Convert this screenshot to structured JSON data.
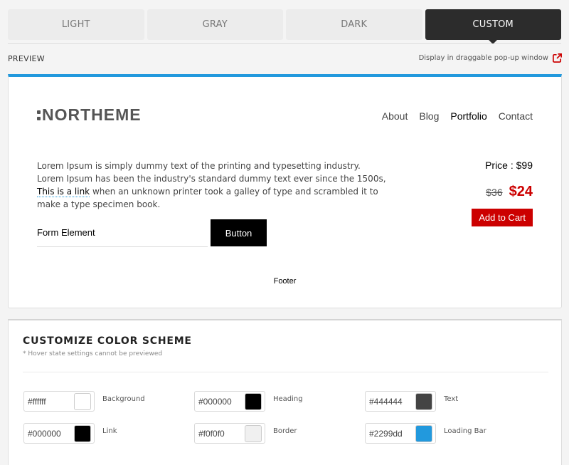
{
  "tabs": [
    {
      "label": "LIGHT",
      "active": false
    },
    {
      "label": "GRAY",
      "active": false
    },
    {
      "label": "DARK",
      "active": false
    },
    {
      "label": "CUSTOM",
      "active": true
    }
  ],
  "preview": {
    "title": "PREVIEW",
    "popup_link": "Display in draggable pop-up window",
    "logo": "NORTHEME",
    "nav": [
      "About",
      "Blog",
      "Portfolio",
      "Contact"
    ],
    "body_text_1": "Lorem Ipsum is simply dummy text of the printing and typesetting industry. Lorem Ipsum has been the industry's standard dummy text ever since the 1500s, ",
    "body_link": "This is a link",
    "body_text_2": " when an unknown printer took a galley of type and scrambled it to make a type specimen book.",
    "form_element": "Form Element",
    "button": "Button",
    "price_label": "Price : $99",
    "old_price": "$36",
    "new_price": "$24",
    "cart_button": "Add to Cart",
    "footer": "Footer"
  },
  "customize": {
    "title": "CUSTOMIZE COLOR SCHEME",
    "note": "* Hover state settings cannot be previewed",
    "swatches": [
      {
        "hex": "#ffffff",
        "label": "Background",
        "color": "#ffffff"
      },
      {
        "hex": "#000000",
        "label": "Heading",
        "color": "#000000"
      },
      {
        "hex": "#444444",
        "label": "Text",
        "color": "#444444"
      },
      {
        "hex": "#000000",
        "label": "Link",
        "color": "#000000"
      },
      {
        "hex": "#f0f0f0",
        "label": "Border",
        "color": "#f0f0f0"
      },
      {
        "hex": "#2299dd",
        "label": "Loading Bar",
        "color": "#2299dd"
      }
    ]
  },
  "colors": {
    "accent": "#2299dd",
    "sale": "#cc0000",
    "tab_active": "#2c2c2c"
  }
}
